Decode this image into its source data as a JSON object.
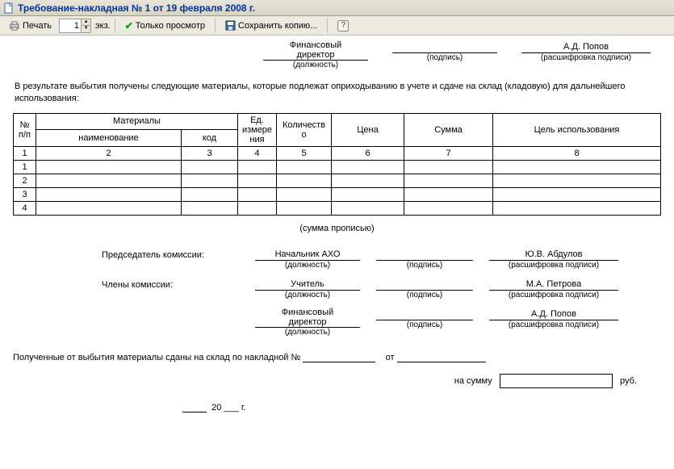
{
  "window": {
    "title": "Требование-накладная № 1 от 19 февраля 2008 г."
  },
  "toolbar": {
    "print": "Печать",
    "copies_value": "1",
    "copies_unit": "экз.",
    "view_only": "Только просмотр",
    "save_copy": "Сохранить копию...",
    "help": "?"
  },
  "top_sig": {
    "position1": "Финансовый",
    "position2": "директор",
    "position_caption": "(должность)",
    "sign_caption": "(подпись)",
    "name": "А.Д. Попов",
    "name_caption": "(расшифровка подписи)"
  },
  "paragraph": "В результате выбытия получены следующие материалы, которые подлежат оприходыванию в учете и сдаче на склад (кладовую) для дальнейшего использования:",
  "table": {
    "headers": {
      "npp": "№ п/п",
      "materials": "Материалы",
      "materials_name": "наименование",
      "materials_code": "код",
      "unit": "Ед. измере ния",
      "qty": "Количеств о",
      "price": "Цена",
      "sum": "Сумма",
      "purpose": "Цель использования"
    },
    "colnums": [
      "1",
      "2",
      "3",
      "4",
      "5",
      "6",
      "7",
      "8"
    ],
    "rows": [
      "1",
      "2",
      "3",
      "4"
    ]
  },
  "sum_words_caption": "(сумма прописью)",
  "commission": {
    "chair_label": "Председатель комиссии:",
    "members_label": "Члены комиссии:",
    "pos_caption": "(должность)",
    "sign_caption": "(подпись)",
    "name_caption": "(расшифровка подписи)",
    "rows": [
      {
        "position": "Начальник АХО",
        "name": "Ю.В. Абдулов"
      },
      {
        "position": "Учитель",
        "name": "М.А. Петрова"
      },
      {
        "position_l1": "Финансовый",
        "position_l2": "директор",
        "name": "А.Д. Попов"
      }
    ]
  },
  "delivered": {
    "text": "Полученные от выбытия материалы сданы на склад по накладной №",
    "from": "от",
    "sum_label": "на сумму",
    "currency": "руб.",
    "year_suffix": "20 ___ г."
  }
}
